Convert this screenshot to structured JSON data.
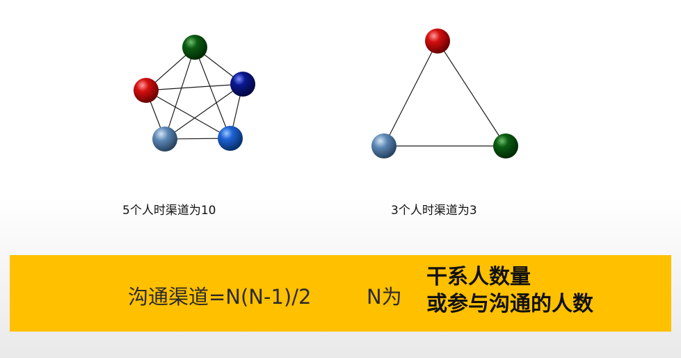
{
  "captions": {
    "five": "5个人时渠道为10",
    "three": "3个人时渠道为3"
  },
  "banner": {
    "formula": "沟通渠道=N(N-1)/2",
    "n_label": "N为",
    "definition_line1": "干系人数量",
    "definition_line2": "或参与沟通的人数",
    "color": "#ffc000"
  },
  "node_colors": {
    "green": "#0b5c12",
    "red": "#d40f0f",
    "navy": "#0a1890",
    "steel_blue": "#5a86b4",
    "blue": "#1d63d4"
  },
  "networks": [
    {
      "people": 5,
      "channels": 10,
      "node_colors": [
        "green",
        "red",
        "navy",
        "steel_blue",
        "blue"
      ]
    },
    {
      "people": 3,
      "channels": 3,
      "node_colors": [
        "red",
        "steel_blue",
        "green"
      ]
    }
  ]
}
